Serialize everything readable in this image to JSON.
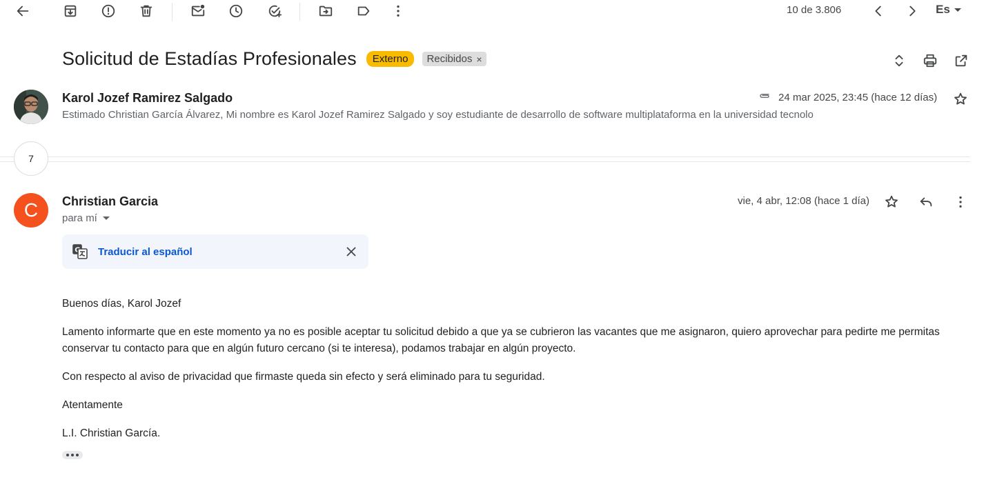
{
  "toolbar": {
    "icons": [
      "back-arrow-icon",
      "archive-icon",
      "report-spam-icon",
      "delete-icon",
      "mark-unread-icon",
      "snooze-icon",
      "add-task-icon",
      "move-to-icon",
      "label-icon",
      "more-vert-icon"
    ],
    "counter": "10 de 3.806",
    "language": "Es"
  },
  "subject": {
    "title": "Solicitud de Estadías Profesionales",
    "external_label": "Externo",
    "inbox_label": "Recibidos",
    "chip_remove_glyph": "×"
  },
  "message1": {
    "sender": "Karol Jozef Ramirez Salgado",
    "date": "24 mar 2025, 23:45 (hace 12 días)",
    "snippet": "Estimado Christian García Álvarez, Mi nombre es Karol Jozef Ramirez Salgado y soy estudiante de desarrollo de software multiplataforma en la universidad tecnolo"
  },
  "collapsed": {
    "count": "7"
  },
  "message2": {
    "avatar_letter": "C",
    "sender": "Christian Garcia",
    "to": "para mí",
    "date": "vie, 4 abr, 12:08 (hace 1 día)",
    "translate": "Traducir al español",
    "body": [
      "Buenos días, Karol Jozef",
      "Lamento informarte que en este momento ya no es posible aceptar tu solicitud debido a que ya se cubrieron las vacantes que me asignaron, quiero aprovechar para pedirte me permitas conservar tu contacto para que en algún futuro cercano (si te interesa), podamos trabajar en algún proyecto.",
      "Con respecto al aviso de privacidad que firmaste queda sin efecto y será eliminado para tu seguridad.",
      "Atentamente",
      "L.I. Christian García."
    ]
  },
  "colors": {
    "external_chip": "#f9bb00",
    "avatar_c": "#f4511e",
    "link": "#0b57d0",
    "translate_bg": "#f2f6fc"
  }
}
